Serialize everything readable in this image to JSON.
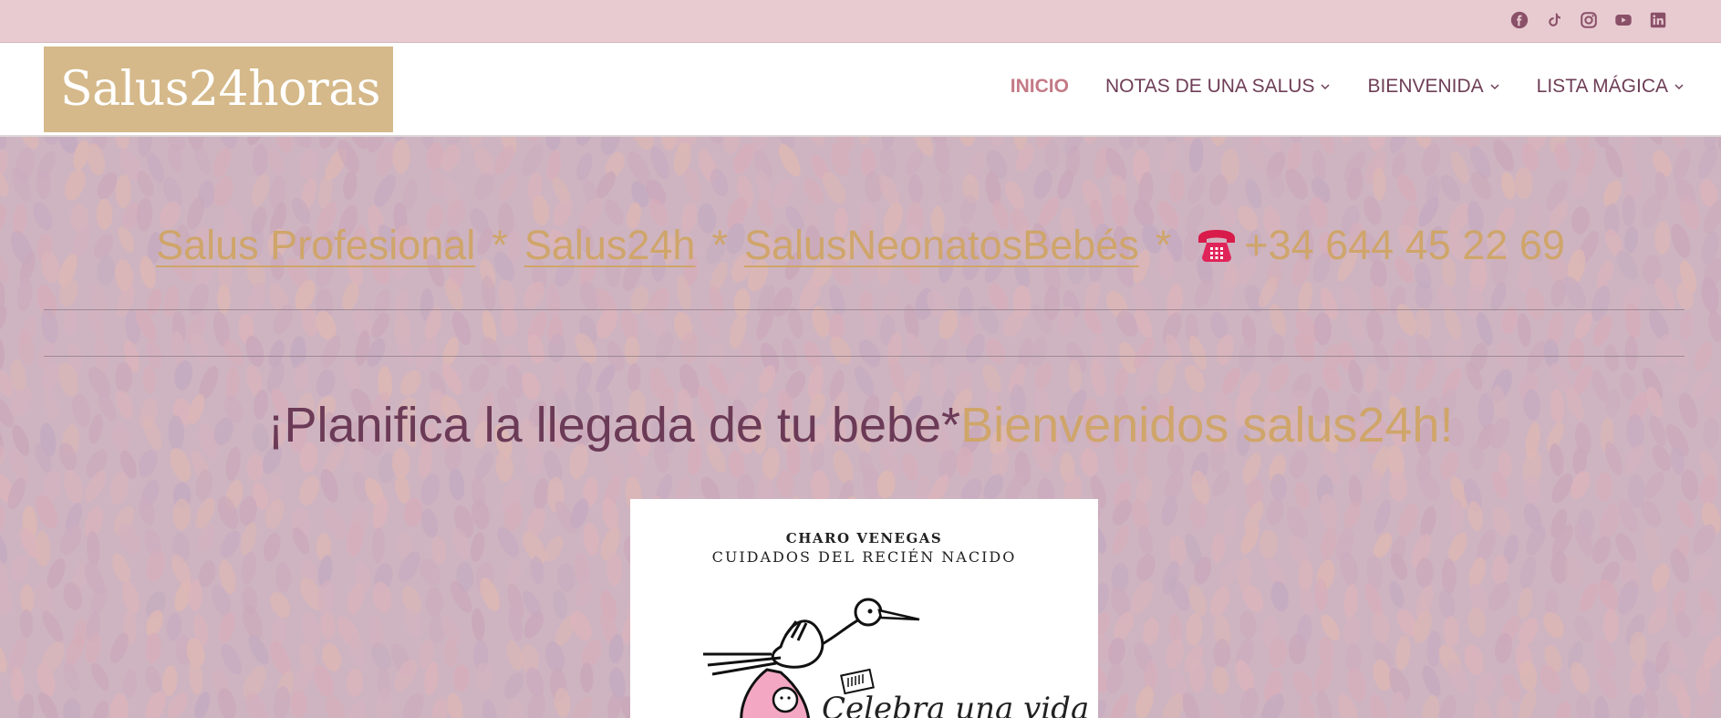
{
  "topbar": {
    "social_icons": [
      "facebook-icon",
      "tiktok-icon",
      "instagram-icon",
      "youtube-icon",
      "linkedin-icon"
    ]
  },
  "header": {
    "logo": "Salus24horas",
    "nav": [
      {
        "label": "INICIO",
        "active": true,
        "dropdown": false
      },
      {
        "label": "NOTAS DE UNA SALUS",
        "active": false,
        "dropdown": true
      },
      {
        "label": "BIENVENIDA",
        "active": false,
        "dropdown": true
      },
      {
        "label": "LISTA MÁGICA",
        "active": false,
        "dropdown": true
      }
    ]
  },
  "hero": {
    "links": [
      "Salus Profesional",
      "Salus24h",
      "SalusNeonatosBebés"
    ],
    "separator": "*",
    "phone": "+34 644 45 22 69",
    "headline_part1": "¡Planifica la llegada de tu bebe*",
    "headline_part2": "Bienvenidos salus24h!",
    "poster": {
      "name": "CHARO VENEGAS",
      "subtitle": "CUIDADOS DEL RECIÉN NACIDO",
      "script": "Celebra una vida"
    }
  },
  "colors": {
    "topbar": "#e8cbd1",
    "logo_bg": "#d5b98a",
    "nav_text": "#6e3d56",
    "nav_active": "#c47a86",
    "gold": "#cfa56a",
    "plum": "#6b3a56"
  }
}
